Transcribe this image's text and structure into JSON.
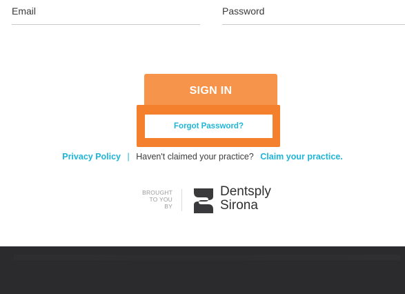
{
  "form": {
    "email_label": "Email",
    "password_label": "Password",
    "signin_label": "SIGN IN",
    "forgot_label": "Forgot Password?"
  },
  "links": {
    "privacy": "Privacy Policy",
    "separator": "|",
    "claim_question": "Haven't claimed your practice?",
    "claim_link": "Claim your practice."
  },
  "brand": {
    "brought_line1": "BROUGHT",
    "brought_line2": "TO YOU",
    "brought_line3": "BY",
    "name_line1": "Dentsply",
    "name_line2": "Sirona"
  },
  "colors": {
    "accent_orange": "#f7944b",
    "highlight_orange": "#f47f2c",
    "link_blue": "#1fb5d7",
    "footer_dark": "#2b2b2d"
  }
}
